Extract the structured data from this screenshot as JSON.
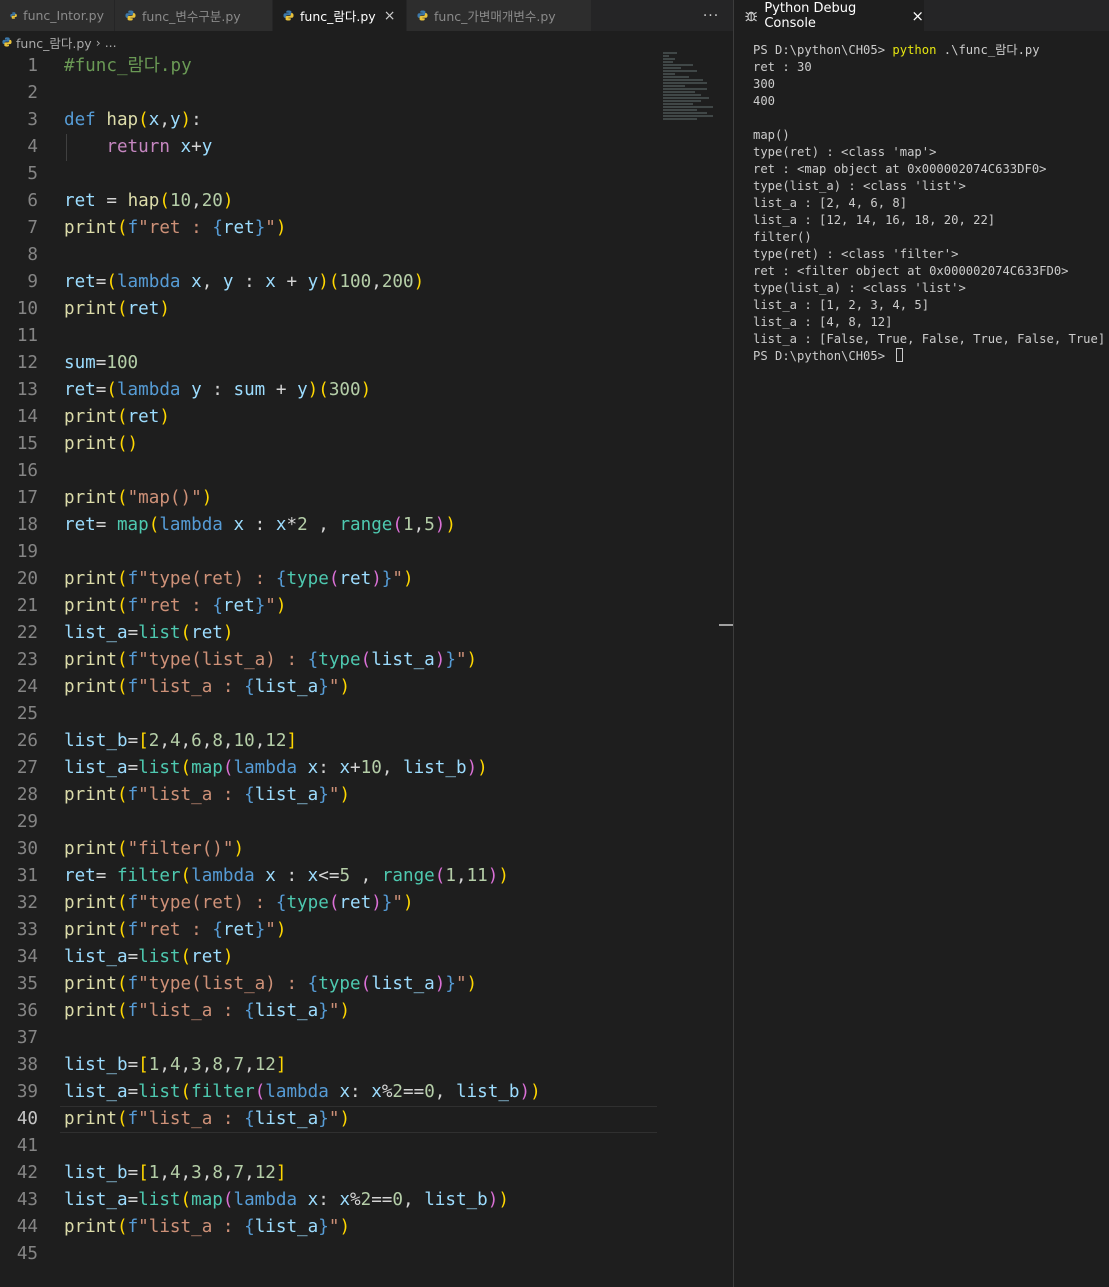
{
  "colors": {
    "background": "#1e1e1e",
    "tabbar": "#252526",
    "keyword": "#569cd6",
    "control": "#c586c0",
    "function": "#dcdcaa",
    "variable": "#9cdcfe",
    "number": "#b5cea8",
    "string": "#ce9178",
    "builtin": "#4ec9b0",
    "comment": "#6a9955"
  },
  "tabs": [
    {
      "label": "func_Intor.py",
      "active": false,
      "icon": "python-file-icon"
    },
    {
      "label": "func_변수구분.py",
      "active": false,
      "icon": "python-file-icon"
    },
    {
      "label": "func_람다.py",
      "active": true,
      "icon": "python-file-icon",
      "close": "×"
    },
    {
      "label": "func_가변매개변수.py",
      "active": false,
      "icon": "python-file-icon"
    }
  ],
  "tab_more": "···",
  "breadcrumb": {
    "file": "func_람다.py",
    "separator": "›",
    "more": "..."
  },
  "current_line": 40,
  "code_lines": [
    [
      [
        "c-cmt",
        "#func_람다.py"
      ]
    ],
    [],
    [
      [
        "c-kw",
        "def "
      ],
      [
        "c-fn",
        "hap"
      ],
      [
        "b1",
        "("
      ],
      [
        "c-var",
        "x"
      ],
      [
        "c-op",
        ","
      ],
      [
        "c-var",
        "y"
      ],
      [
        "b1",
        ")"
      ],
      [
        "c-op",
        ":"
      ]
    ],
    [
      [
        "c-op",
        "    "
      ],
      [
        "c-ctl",
        "return"
      ],
      [
        "c-op",
        " "
      ],
      [
        "c-var",
        "x"
      ],
      [
        "c-op",
        "+"
      ],
      [
        "c-var",
        "y"
      ]
    ],
    [],
    [
      [
        "c-var",
        "ret"
      ],
      [
        "c-op",
        " = "
      ],
      [
        "c-fn",
        "hap"
      ],
      [
        "b1",
        "("
      ],
      [
        "c-num",
        "10"
      ],
      [
        "c-op",
        ","
      ],
      [
        "c-num",
        "20"
      ],
      [
        "b1",
        ")"
      ]
    ],
    [
      [
        "c-fn",
        "print"
      ],
      [
        "b1",
        "("
      ],
      [
        "c-kw",
        "f"
      ],
      [
        "c-str",
        "\"ret : "
      ],
      [
        "c-kw",
        "{"
      ],
      [
        "c-var",
        "ret"
      ],
      [
        "c-kw",
        "}"
      ],
      [
        "c-str",
        "\""
      ],
      [
        "b1",
        ")"
      ]
    ],
    [],
    [
      [
        "c-var",
        "ret"
      ],
      [
        "c-op",
        "="
      ],
      [
        "b1",
        "("
      ],
      [
        "c-kw",
        "lambda"
      ],
      [
        "c-op",
        " "
      ],
      [
        "c-var",
        "x"
      ],
      [
        "c-op",
        ", "
      ],
      [
        "c-var",
        "y"
      ],
      [
        "c-op",
        " : "
      ],
      [
        "c-var",
        "x"
      ],
      [
        "c-op",
        " + "
      ],
      [
        "c-var",
        "y"
      ],
      [
        "b1",
        ")"
      ],
      [
        "b1",
        "("
      ],
      [
        "c-num",
        "100"
      ],
      [
        "c-op",
        ","
      ],
      [
        "c-num",
        "200"
      ],
      [
        "b1",
        ")"
      ]
    ],
    [
      [
        "c-fn",
        "print"
      ],
      [
        "b1",
        "("
      ],
      [
        "c-var",
        "ret"
      ],
      [
        "b1",
        ")"
      ]
    ],
    [],
    [
      [
        "c-var",
        "sum"
      ],
      [
        "c-op",
        "="
      ],
      [
        "c-num",
        "100"
      ]
    ],
    [
      [
        "c-var",
        "ret"
      ],
      [
        "c-op",
        "="
      ],
      [
        "b1",
        "("
      ],
      [
        "c-kw",
        "lambda"
      ],
      [
        "c-op",
        " "
      ],
      [
        "c-var",
        "y"
      ],
      [
        "c-op",
        " : "
      ],
      [
        "c-var",
        "sum"
      ],
      [
        "c-op",
        " + "
      ],
      [
        "c-var",
        "y"
      ],
      [
        "b1",
        ")"
      ],
      [
        "b1",
        "("
      ],
      [
        "c-num",
        "300"
      ],
      [
        "b1",
        ")"
      ]
    ],
    [
      [
        "c-fn",
        "print"
      ],
      [
        "b1",
        "("
      ],
      [
        "c-var",
        "ret"
      ],
      [
        "b1",
        ")"
      ]
    ],
    [
      [
        "c-fn",
        "print"
      ],
      [
        "b1",
        "()"
      ]
    ],
    [],
    [
      [
        "c-fn",
        "print"
      ],
      [
        "b1",
        "("
      ],
      [
        "c-str",
        "\"map()\""
      ],
      [
        "b1",
        ")"
      ]
    ],
    [
      [
        "c-var",
        "ret"
      ],
      [
        "c-op",
        "= "
      ],
      [
        "c-bi",
        "map"
      ],
      [
        "b1",
        "("
      ],
      [
        "c-kw",
        "lambda"
      ],
      [
        "c-op",
        " "
      ],
      [
        "c-var",
        "x"
      ],
      [
        "c-op",
        " : "
      ],
      [
        "c-var",
        "x"
      ],
      [
        "c-op",
        "*"
      ],
      [
        "c-num",
        "2"
      ],
      [
        "c-op",
        " , "
      ],
      [
        "c-bi",
        "range"
      ],
      [
        "b2",
        "("
      ],
      [
        "c-num",
        "1"
      ],
      [
        "c-op",
        ","
      ],
      [
        "c-num",
        "5"
      ],
      [
        "b2",
        ")"
      ],
      [
        "b1",
        ")"
      ]
    ],
    [],
    [
      [
        "c-fn",
        "print"
      ],
      [
        "b1",
        "("
      ],
      [
        "c-kw",
        "f"
      ],
      [
        "c-str",
        "\"type(ret) : "
      ],
      [
        "c-kw",
        "{"
      ],
      [
        "c-bi",
        "type"
      ],
      [
        "b2",
        "("
      ],
      [
        "c-var",
        "ret"
      ],
      [
        "b2",
        ")"
      ],
      [
        "c-kw",
        "}"
      ],
      [
        "c-str",
        "\""
      ],
      [
        "b1",
        ")"
      ]
    ],
    [
      [
        "c-fn",
        "print"
      ],
      [
        "b1",
        "("
      ],
      [
        "c-kw",
        "f"
      ],
      [
        "c-str",
        "\"ret : "
      ],
      [
        "c-kw",
        "{"
      ],
      [
        "c-var",
        "ret"
      ],
      [
        "c-kw",
        "}"
      ],
      [
        "c-str",
        "\""
      ],
      [
        "b1",
        ")"
      ]
    ],
    [
      [
        "c-var",
        "list_a"
      ],
      [
        "c-op",
        "="
      ],
      [
        "c-bi",
        "list"
      ],
      [
        "b1",
        "("
      ],
      [
        "c-var",
        "ret"
      ],
      [
        "b1",
        ")"
      ]
    ],
    [
      [
        "c-fn",
        "print"
      ],
      [
        "b1",
        "("
      ],
      [
        "c-kw",
        "f"
      ],
      [
        "c-str",
        "\"type(list_a) : "
      ],
      [
        "c-kw",
        "{"
      ],
      [
        "c-bi",
        "type"
      ],
      [
        "b2",
        "("
      ],
      [
        "c-var",
        "list_a"
      ],
      [
        "b2",
        ")"
      ],
      [
        "c-kw",
        "}"
      ],
      [
        "c-str",
        "\""
      ],
      [
        "b1",
        ")"
      ]
    ],
    [
      [
        "c-fn",
        "print"
      ],
      [
        "b1",
        "("
      ],
      [
        "c-kw",
        "f"
      ],
      [
        "c-str",
        "\"list_a : "
      ],
      [
        "c-kw",
        "{"
      ],
      [
        "c-var",
        "list_a"
      ],
      [
        "c-kw",
        "}"
      ],
      [
        "c-str",
        "\""
      ],
      [
        "b1",
        ")"
      ]
    ],
    [],
    [
      [
        "c-var",
        "list_b"
      ],
      [
        "c-op",
        "="
      ],
      [
        "b1",
        "["
      ],
      [
        "c-num",
        "2"
      ],
      [
        "c-op",
        ","
      ],
      [
        "c-num",
        "4"
      ],
      [
        "c-op",
        ","
      ],
      [
        "c-num",
        "6"
      ],
      [
        "c-op",
        ","
      ],
      [
        "c-num",
        "8"
      ],
      [
        "c-op",
        ","
      ],
      [
        "c-num",
        "10"
      ],
      [
        "c-op",
        ","
      ],
      [
        "c-num",
        "12"
      ],
      [
        "b1",
        "]"
      ]
    ],
    [
      [
        "c-var",
        "list_a"
      ],
      [
        "c-op",
        "="
      ],
      [
        "c-bi",
        "list"
      ],
      [
        "b1",
        "("
      ],
      [
        "c-bi",
        "map"
      ],
      [
        "b2",
        "("
      ],
      [
        "c-kw",
        "lambda"
      ],
      [
        "c-op",
        " "
      ],
      [
        "c-var",
        "x"
      ],
      [
        "c-op",
        ": "
      ],
      [
        "c-var",
        "x"
      ],
      [
        "c-op",
        "+"
      ],
      [
        "c-num",
        "10"
      ],
      [
        "c-op",
        ", "
      ],
      [
        "c-var",
        "list_b"
      ],
      [
        "b2",
        ")"
      ],
      [
        "b1",
        ")"
      ]
    ],
    [
      [
        "c-fn",
        "print"
      ],
      [
        "b1",
        "("
      ],
      [
        "c-kw",
        "f"
      ],
      [
        "c-str",
        "\"list_a : "
      ],
      [
        "c-kw",
        "{"
      ],
      [
        "c-var",
        "list_a"
      ],
      [
        "c-kw",
        "}"
      ],
      [
        "c-str",
        "\""
      ],
      [
        "b1",
        ")"
      ]
    ],
    [],
    [
      [
        "c-fn",
        "print"
      ],
      [
        "b1",
        "("
      ],
      [
        "c-str",
        "\"filter()\""
      ],
      [
        "b1",
        ")"
      ]
    ],
    [
      [
        "c-var",
        "ret"
      ],
      [
        "c-op",
        "= "
      ],
      [
        "c-bi",
        "filter"
      ],
      [
        "b1",
        "("
      ],
      [
        "c-kw",
        "lambda"
      ],
      [
        "c-op",
        " "
      ],
      [
        "c-var",
        "x"
      ],
      [
        "c-op",
        " : "
      ],
      [
        "c-var",
        "x"
      ],
      [
        "c-op",
        "<="
      ],
      [
        "c-num",
        "5"
      ],
      [
        "c-op",
        " , "
      ],
      [
        "c-bi",
        "range"
      ],
      [
        "b2",
        "("
      ],
      [
        "c-num",
        "1"
      ],
      [
        "c-op",
        ","
      ],
      [
        "c-num",
        "11"
      ],
      [
        "b2",
        ")"
      ],
      [
        "b1",
        ")"
      ]
    ],
    [
      [
        "c-fn",
        "print"
      ],
      [
        "b1",
        "("
      ],
      [
        "c-kw",
        "f"
      ],
      [
        "c-str",
        "\"type(ret) : "
      ],
      [
        "c-kw",
        "{"
      ],
      [
        "c-bi",
        "type"
      ],
      [
        "b2",
        "("
      ],
      [
        "c-var",
        "ret"
      ],
      [
        "b2",
        ")"
      ],
      [
        "c-kw",
        "}"
      ],
      [
        "c-str",
        "\""
      ],
      [
        "b1",
        ")"
      ]
    ],
    [
      [
        "c-fn",
        "print"
      ],
      [
        "b1",
        "("
      ],
      [
        "c-kw",
        "f"
      ],
      [
        "c-str",
        "\"ret : "
      ],
      [
        "c-kw",
        "{"
      ],
      [
        "c-var",
        "ret"
      ],
      [
        "c-kw",
        "}"
      ],
      [
        "c-str",
        "\""
      ],
      [
        "b1",
        ")"
      ]
    ],
    [
      [
        "c-var",
        "list_a"
      ],
      [
        "c-op",
        "="
      ],
      [
        "c-bi",
        "list"
      ],
      [
        "b1",
        "("
      ],
      [
        "c-var",
        "ret"
      ],
      [
        "b1",
        ")"
      ]
    ],
    [
      [
        "c-fn",
        "print"
      ],
      [
        "b1",
        "("
      ],
      [
        "c-kw",
        "f"
      ],
      [
        "c-str",
        "\"type(list_a) : "
      ],
      [
        "c-kw",
        "{"
      ],
      [
        "c-bi",
        "type"
      ],
      [
        "b2",
        "("
      ],
      [
        "c-var",
        "list_a"
      ],
      [
        "b2",
        ")"
      ],
      [
        "c-kw",
        "}"
      ],
      [
        "c-str",
        "\""
      ],
      [
        "b1",
        ")"
      ]
    ],
    [
      [
        "c-fn",
        "print"
      ],
      [
        "b1",
        "("
      ],
      [
        "c-kw",
        "f"
      ],
      [
        "c-str",
        "\"list_a : "
      ],
      [
        "c-kw",
        "{"
      ],
      [
        "c-var",
        "list_a"
      ],
      [
        "c-kw",
        "}"
      ],
      [
        "c-str",
        "\""
      ],
      [
        "b1",
        ")"
      ]
    ],
    [],
    [
      [
        "c-var",
        "list_b"
      ],
      [
        "c-op",
        "="
      ],
      [
        "b1",
        "["
      ],
      [
        "c-num",
        "1"
      ],
      [
        "c-op",
        ","
      ],
      [
        "c-num",
        "4"
      ],
      [
        "c-op",
        ","
      ],
      [
        "c-num",
        "3"
      ],
      [
        "c-op",
        ","
      ],
      [
        "c-num",
        "8"
      ],
      [
        "c-op",
        ","
      ],
      [
        "c-num",
        "7"
      ],
      [
        "c-op",
        ","
      ],
      [
        "c-num",
        "12"
      ],
      [
        "b1",
        "]"
      ]
    ],
    [
      [
        "c-var",
        "list_a"
      ],
      [
        "c-op",
        "="
      ],
      [
        "c-bi",
        "list"
      ],
      [
        "b1",
        "("
      ],
      [
        "c-bi",
        "filter"
      ],
      [
        "b2",
        "("
      ],
      [
        "c-kw",
        "lambda"
      ],
      [
        "c-op",
        " "
      ],
      [
        "c-var",
        "x"
      ],
      [
        "c-op",
        ": "
      ],
      [
        "c-var",
        "x"
      ],
      [
        "c-op",
        "%"
      ],
      [
        "c-num",
        "2"
      ],
      [
        "c-op",
        "=="
      ],
      [
        "c-num",
        "0"
      ],
      [
        "c-op",
        ", "
      ],
      [
        "c-var",
        "list_b"
      ],
      [
        "b2",
        ")"
      ],
      [
        "b1",
        ")"
      ]
    ],
    [
      [
        "c-fn",
        "print"
      ],
      [
        "b1",
        "("
      ],
      [
        "c-kw",
        "f"
      ],
      [
        "c-str",
        "\"list_a : "
      ],
      [
        "c-kw",
        "{"
      ],
      [
        "c-var",
        "list_a"
      ],
      [
        "c-kw",
        "}"
      ],
      [
        "c-str",
        "\""
      ],
      [
        "b1",
        ")"
      ]
    ],
    [],
    [
      [
        "c-var",
        "list_b"
      ],
      [
        "c-op",
        "="
      ],
      [
        "b1",
        "["
      ],
      [
        "c-num",
        "1"
      ],
      [
        "c-op",
        ","
      ],
      [
        "c-num",
        "4"
      ],
      [
        "c-op",
        ","
      ],
      [
        "c-num",
        "3"
      ],
      [
        "c-op",
        ","
      ],
      [
        "c-num",
        "8"
      ],
      [
        "c-op",
        ","
      ],
      [
        "c-num",
        "7"
      ],
      [
        "c-op",
        ","
      ],
      [
        "c-num",
        "12"
      ],
      [
        "b1",
        "]"
      ]
    ],
    [
      [
        "c-var",
        "list_a"
      ],
      [
        "c-op",
        "="
      ],
      [
        "c-bi",
        "list"
      ],
      [
        "b1",
        "("
      ],
      [
        "c-bi",
        "map"
      ],
      [
        "b2",
        "("
      ],
      [
        "c-kw",
        "lambda"
      ],
      [
        "c-op",
        " "
      ],
      [
        "c-var",
        "x"
      ],
      [
        "c-op",
        ": "
      ],
      [
        "c-var",
        "x"
      ],
      [
        "c-op",
        "%"
      ],
      [
        "c-num",
        "2"
      ],
      [
        "c-op",
        "=="
      ],
      [
        "c-num",
        "0"
      ],
      [
        "c-op",
        ", "
      ],
      [
        "c-var",
        "list_b"
      ],
      [
        "b2",
        ")"
      ],
      [
        "b1",
        ")"
      ]
    ],
    [
      [
        "c-fn",
        "print"
      ],
      [
        "b1",
        "("
      ],
      [
        "c-kw",
        "f"
      ],
      [
        "c-str",
        "\"list_a : "
      ],
      [
        "c-kw",
        "{"
      ],
      [
        "c-var",
        "list_a"
      ],
      [
        "c-kw",
        "}"
      ],
      [
        "c-str",
        "\""
      ],
      [
        "b1",
        ")"
      ]
    ],
    []
  ],
  "console": {
    "title": "Python Debug Console",
    "close": "×",
    "prompt": "PS D:\\python\\CH05> ",
    "command": "python",
    "command_args": " .\\func_람다.py",
    "output": [
      "ret : 30",
      "300",
      "400",
      "",
      "map()",
      "type(ret) : <class 'map'>",
      "ret : <map object at 0x000002074C633DF0>",
      "type(list_a) : <class 'list'>",
      "list_a : [2, 4, 6, 8]",
      "list_a : [12, 14, 16, 18, 20, 22]",
      "filter()",
      "type(ret) : <class 'filter'>",
      "ret : <filter object at 0x000002074C633FD0>",
      "type(list_a) : <class 'list'>",
      "list_a : [1, 2, 3, 4, 5]",
      "list_a : [4, 8, 12]",
      "list_a : [False, True, False, True, False, True]"
    ],
    "final_prompt": "PS D:\\python\\CH05> "
  }
}
